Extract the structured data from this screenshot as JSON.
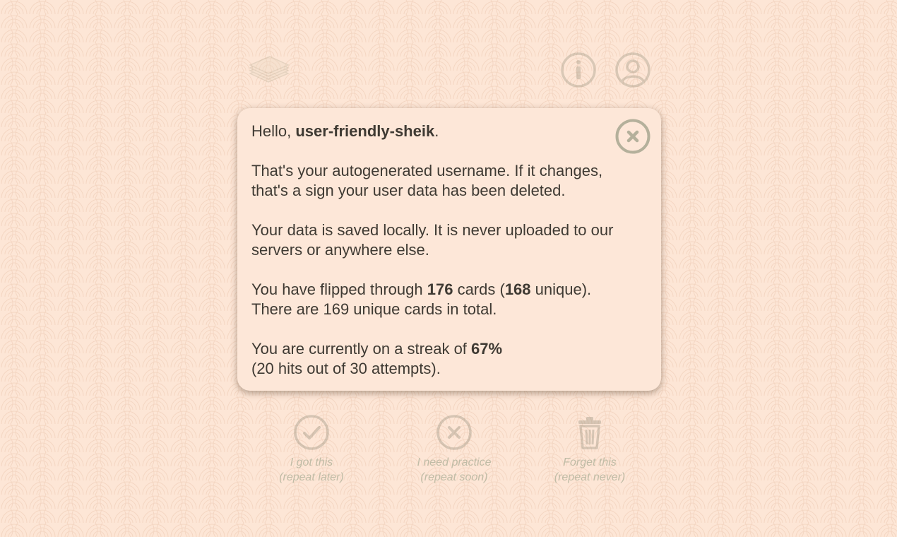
{
  "background": {
    "color": "#fde6d6",
    "pattern": "seigaiha-waves"
  },
  "header": {
    "icons": [
      "card-deck-icon",
      "info-icon",
      "user-profile-icon"
    ]
  },
  "modal": {
    "greeting_prefix": "Hello, ",
    "username": "user-friendly-sheik",
    "greeting_suffix": ".",
    "username_info_line1": "That's your autogenerated username. If it changes,",
    "username_info_line2": "that's a sign your user data has been deleted.",
    "storage_line1": "Your data is saved locally. It is never uploaded to our",
    "storage_line2": "servers or anywhere else.",
    "flipped_prefix": "You have flipped through ",
    "flipped_count": "176",
    "flipped_mid": " cards (",
    "unique_count": "168",
    "flipped_suffix": " unique).",
    "total_line": "There are 169 unique cards in total.",
    "streak_prefix": "You are currently on a streak of ",
    "streak_percent": "67%",
    "streak_detail": "(20 hits out of 30 attempts).",
    "close_icon": "close-circle-icon"
  },
  "actions": [
    {
      "icon": "check-circle-icon",
      "line1": "I got this",
      "line2": "(repeat later)"
    },
    {
      "icon": "x-circle-icon",
      "line1": "I need practice",
      "line2": "(repeat soon)"
    },
    {
      "icon": "trash-icon",
      "line1": "Forget this",
      "line2": "(repeat never)"
    }
  ],
  "colors": {
    "text": "#3f3a33",
    "icon_gray": "#b4b09b",
    "faded_label": "#c0bca6"
  }
}
